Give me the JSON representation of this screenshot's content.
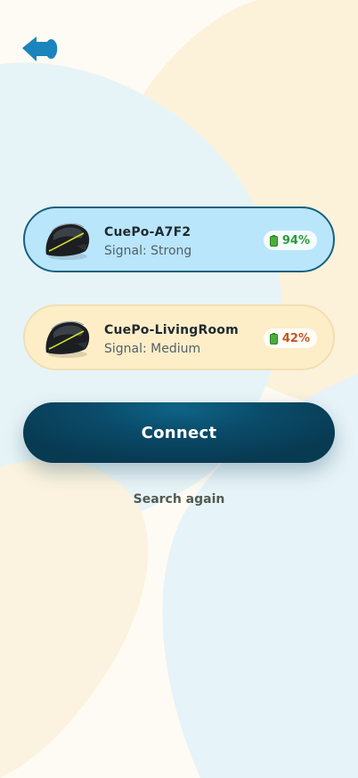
{
  "theme": {
    "selected_card_bg": "#b9e6fb",
    "selected_card_border": "#17607f",
    "unselected_card_bg": "#fdeec8",
    "connect_button_color": "#0a4c6a",
    "strong_battery_color": "#2a9a3a",
    "medium_battery_color": "#c8541e"
  },
  "header": {
    "back_icon": "back-arrow-icon"
  },
  "devices": [
    {
      "name": "CuePo-A7F2",
      "signal": "Signal: Strong",
      "battery": "94%",
      "battery_icon": "battery-icon",
      "selected": true
    },
    {
      "name": "CuePo-LivingRoom",
      "signal": "Signal: Medium",
      "battery": "42%",
      "battery_icon": "battery-icon",
      "selected": false
    }
  ],
  "actions": {
    "connect_label": "Connect",
    "search_again_label": "Search again"
  }
}
